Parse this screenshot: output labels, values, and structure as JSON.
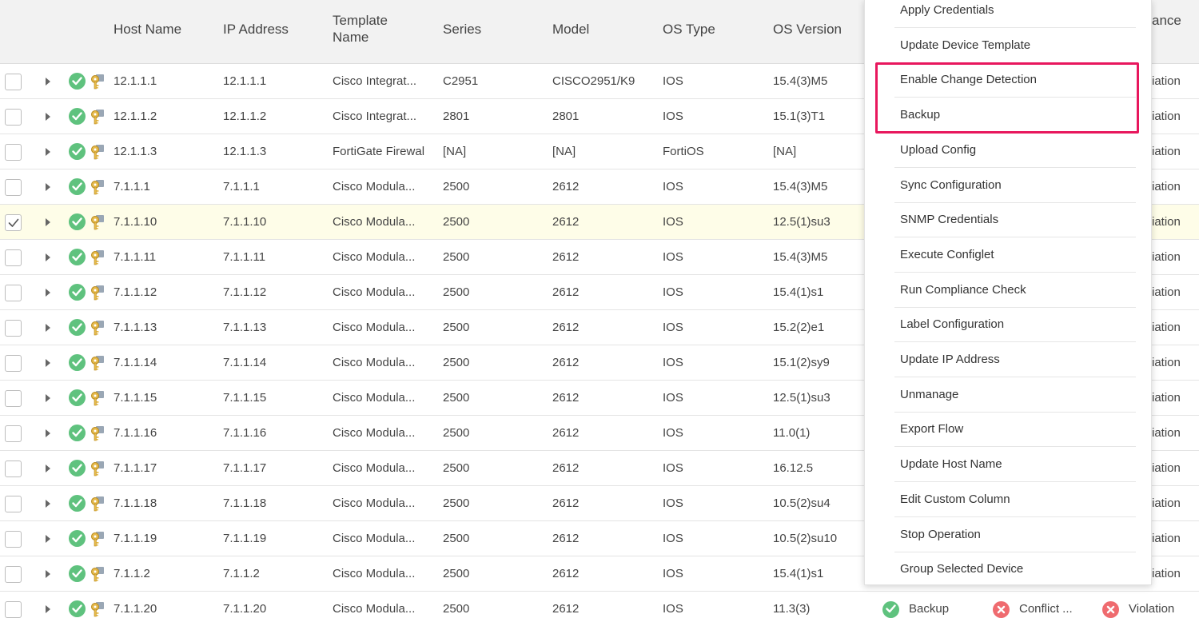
{
  "columns": {
    "host_name": "Host Name",
    "ip_address": "IP Address",
    "template_name": "Template Name",
    "series": "Series",
    "model": "Model",
    "os_type": "OS Type",
    "os_version": "OS Version",
    "compliance_partial": "ance"
  },
  "rows": [
    {
      "host": "12.1.1.1",
      "ip": "12.1.1.1",
      "template": "Cisco Integrat...",
      "series": "C2951",
      "model": "CISCO2951/K9",
      "os_type": "IOS",
      "os_version": "15.4(3)M5",
      "compliance_partial": "iation",
      "selected": false
    },
    {
      "host": "12.1.1.2",
      "ip": "12.1.1.2",
      "template": "Cisco Integrat...",
      "series": "2801",
      "model": "2801",
      "os_type": "IOS",
      "os_version": "15.1(3)T1",
      "compliance_partial": "iation",
      "selected": false
    },
    {
      "host": "12.1.1.3",
      "ip": "12.1.1.3",
      "template": "FortiGate Firewal",
      "series": "[NA]",
      "model": "[NA]",
      "os_type": "FortiOS",
      "os_version": "[NA]",
      "compliance_partial": "iation",
      "selected": false
    },
    {
      "host": "7.1.1.1",
      "ip": "7.1.1.1",
      "template": "Cisco Modula...",
      "series": "2500",
      "model": "2612",
      "os_type": "IOS",
      "os_version": "15.4(3)M5",
      "compliance_partial": "iation",
      "selected": false
    },
    {
      "host": "7.1.1.10",
      "ip": "7.1.1.10",
      "template": "Cisco Modula...",
      "series": "2500",
      "model": "2612",
      "os_type": "IOS",
      "os_version": "12.5(1)su3",
      "compliance_partial": "iation",
      "selected": true
    },
    {
      "host": "7.1.1.11",
      "ip": "7.1.1.11",
      "template": "Cisco Modula...",
      "series": "2500",
      "model": "2612",
      "os_type": "IOS",
      "os_version": "15.4(3)M5",
      "compliance_partial": "iation",
      "selected": false
    },
    {
      "host": "7.1.1.12",
      "ip": "7.1.1.12",
      "template": "Cisco Modula...",
      "series": "2500",
      "model": "2612",
      "os_type": "IOS",
      "os_version": "15.4(1)s1",
      "compliance_partial": "iation",
      "selected": false
    },
    {
      "host": "7.1.1.13",
      "ip": "7.1.1.13",
      "template": "Cisco Modula...",
      "series": "2500",
      "model": "2612",
      "os_type": "IOS",
      "os_version": "15.2(2)e1",
      "compliance_partial": "iation",
      "selected": false
    },
    {
      "host": "7.1.1.14",
      "ip": "7.1.1.14",
      "template": "Cisco Modula...",
      "series": "2500",
      "model": "2612",
      "os_type": "IOS",
      "os_version": "15.1(2)sy9",
      "compliance_partial": "iation",
      "selected": false
    },
    {
      "host": "7.1.1.15",
      "ip": "7.1.1.15",
      "template": "Cisco Modula...",
      "series": "2500",
      "model": "2612",
      "os_type": "IOS",
      "os_version": "12.5(1)su3",
      "compliance_partial": "iation",
      "selected": false
    },
    {
      "host": "7.1.1.16",
      "ip": "7.1.1.16",
      "template": "Cisco Modula...",
      "series": "2500",
      "model": "2612",
      "os_type": "IOS",
      "os_version": "11.0(1)",
      "compliance_partial": "iation",
      "selected": false
    },
    {
      "host": "7.1.1.17",
      "ip": "7.1.1.17",
      "template": "Cisco Modula...",
      "series": "2500",
      "model": "2612",
      "os_type": "IOS",
      "os_version": "16.12.5",
      "compliance_partial": "iation",
      "selected": false
    },
    {
      "host": "7.1.1.18",
      "ip": "7.1.1.18",
      "template": "Cisco Modula...",
      "series": "2500",
      "model": "2612",
      "os_type": "IOS",
      "os_version": "10.5(2)su4",
      "compliance_partial": "iation",
      "selected": false
    },
    {
      "host": "7.1.1.19",
      "ip": "7.1.1.19",
      "template": "Cisco Modula...",
      "series": "2500",
      "model": "2612",
      "os_type": "IOS",
      "os_version": "10.5(2)su10",
      "compliance_partial": "iation",
      "selected": false
    },
    {
      "host": "7.1.1.2",
      "ip": "7.1.1.2",
      "template": "Cisco Modula...",
      "series": "2500",
      "model": "2612",
      "os_type": "IOS",
      "os_version": "15.4(1)s1",
      "compliance_partial": "iation",
      "selected": false
    },
    {
      "host": "7.1.1.20",
      "ip": "7.1.1.20",
      "template": "Cisco Modula...",
      "series": "2500",
      "model": "2612",
      "os_type": "IOS",
      "os_version": "11.3(3)",
      "compliance_partial": "",
      "selected": false
    }
  ],
  "last_row_status": {
    "backup": "Backup",
    "conflict": "Conflict ...",
    "violation": "Violation"
  },
  "context_menu": {
    "items": [
      "Apply Credentials",
      "Update Device Template",
      "Enable Change Detection",
      "Backup",
      "Upload Config",
      "Sync Configuration",
      "SNMP Credentials",
      "Execute Configlet",
      "Run Compliance Check",
      "Label Configuration",
      "Update IP Address",
      "Unmanage",
      "Export Flow",
      "Update Host Name",
      "Edit Custom Column",
      "Stop Operation",
      "Group Selected Device"
    ],
    "highlighted": [
      "Enable Change Detection",
      "Backup"
    ]
  },
  "colors": {
    "ok_green": "#5fc27e",
    "error_red": "#ef6b6f",
    "highlight_border": "#e8175d",
    "selected_row_bg": "#fefde8"
  },
  "icons": {
    "status_ok": "check-circle-icon",
    "credential": "key-icon",
    "expand": "caret-right-icon",
    "error": "x-circle-icon"
  }
}
